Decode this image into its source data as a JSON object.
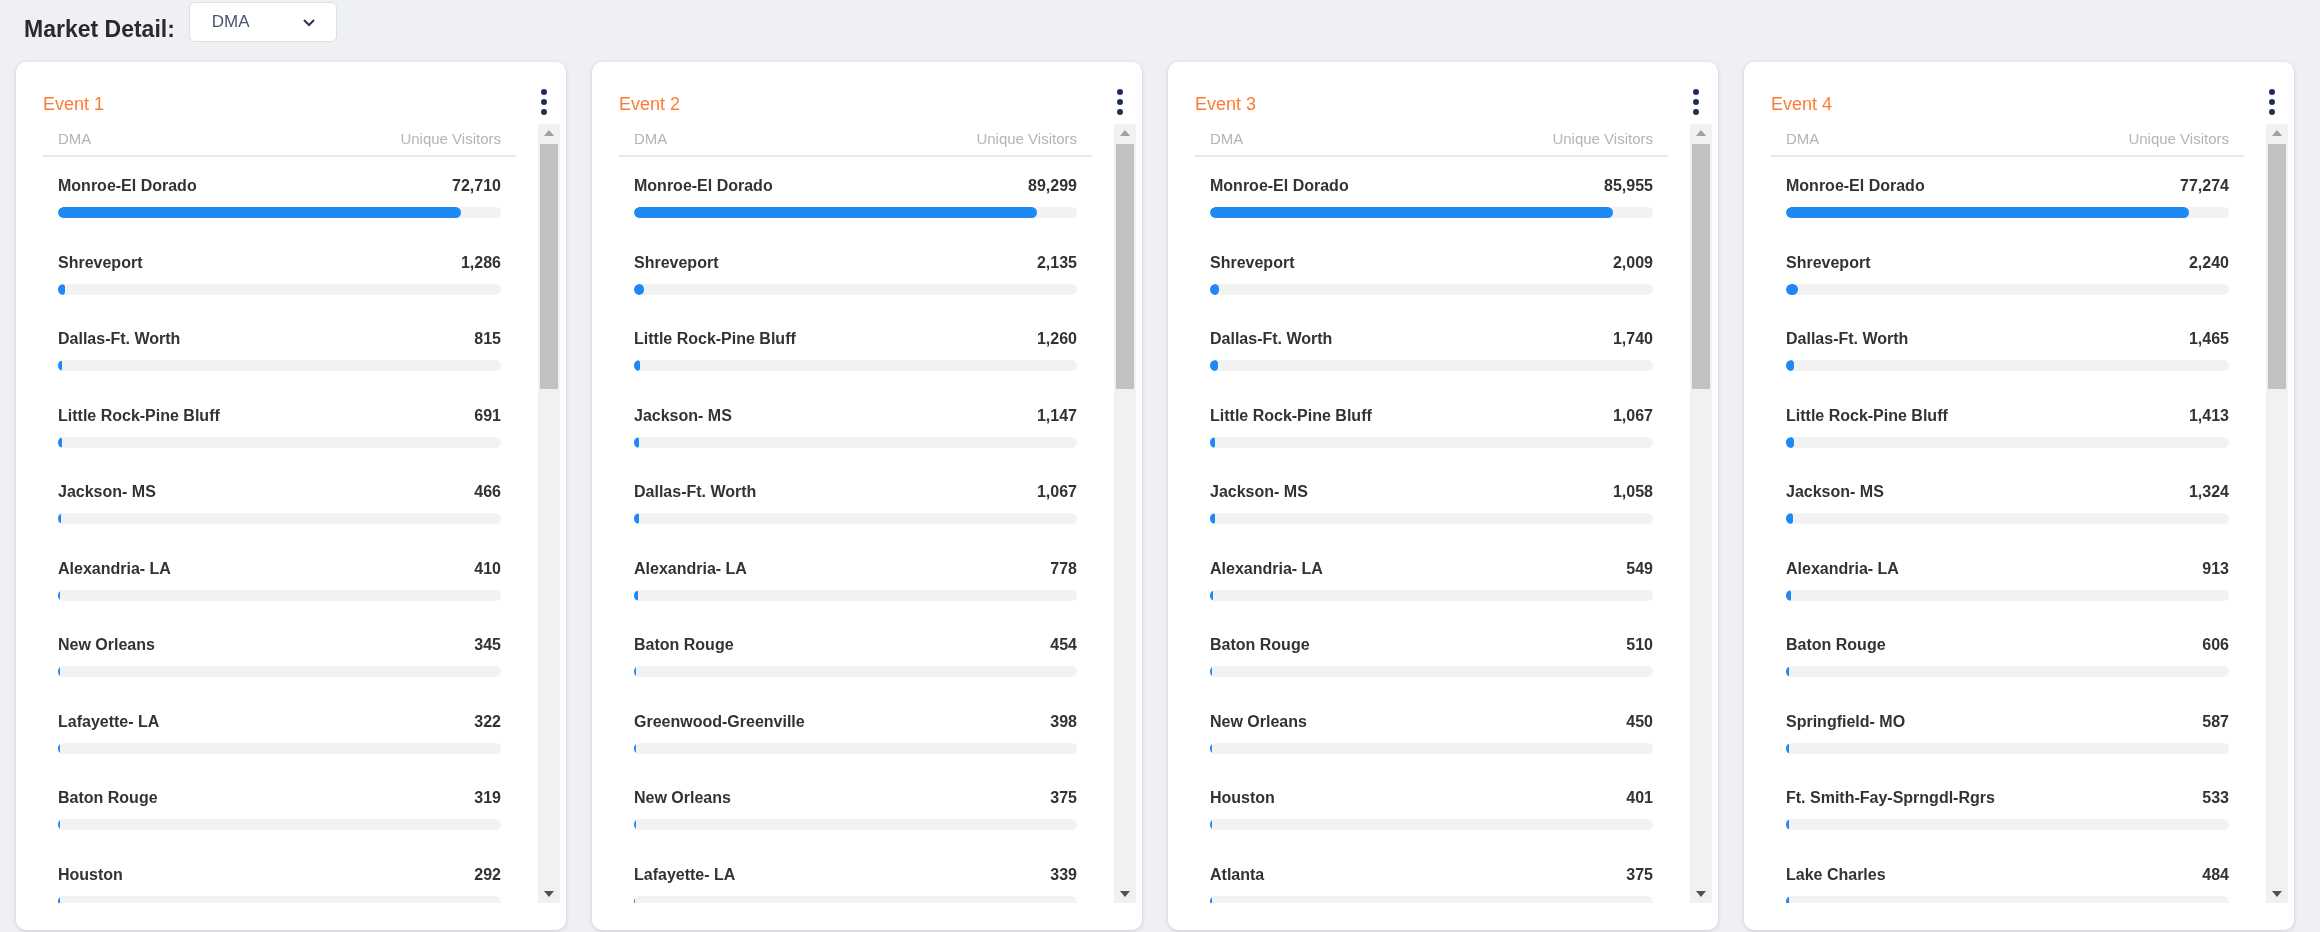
{
  "header": {
    "label": "Market Detail:",
    "dropdown": {
      "value": "DMA"
    }
  },
  "events": [
    {
      "title": "Event 1",
      "columns": [
        "DMA",
        "Unique Visitors"
      ],
      "rows": [
        {
          "name": "Monroe-El Dorado",
          "value": "72,710",
          "level": 0.91
        },
        {
          "name": "Shreveport",
          "value": "1,286",
          "level": 0.016
        },
        {
          "name": "Dallas-Ft. Worth",
          "value": "815",
          "level": 0.01
        },
        {
          "name": "Little Rock-Pine Bluff",
          "value": "691",
          "level": 0.009
        },
        {
          "name": "Jackson- MS",
          "value": "466",
          "level": 0.006
        },
        {
          "name": "Alexandria- LA",
          "value": "410",
          "level": 0.005
        },
        {
          "name": "New Orleans",
          "value": "345",
          "level": 0.004
        },
        {
          "name": "Lafayette- LA",
          "value": "322",
          "level": 0.004
        },
        {
          "name": "Baton Rouge",
          "value": "319",
          "level": 0.004
        },
        {
          "name": "Houston",
          "value": "292",
          "level": 0.004
        }
      ]
    },
    {
      "title": "Event 2",
      "columns": [
        "DMA",
        "Unique Visitors"
      ],
      "rows": [
        {
          "name": "Monroe-El Dorado",
          "value": "89,299",
          "level": 0.91
        },
        {
          "name": "Shreveport",
          "value": "2,135",
          "level": 0.022
        },
        {
          "name": "Little Rock-Pine Bluff",
          "value": "1,260",
          "level": 0.013
        },
        {
          "name": "Jackson- MS",
          "value": "1,147",
          "level": 0.012
        },
        {
          "name": "Dallas-Ft. Worth",
          "value": "1,067",
          "level": 0.011
        },
        {
          "name": "Alexandria- LA",
          "value": "778",
          "level": 0.008
        },
        {
          "name": "Baton Rouge",
          "value": "454",
          "level": 0.005
        },
        {
          "name": "Greenwood-Greenville",
          "value": "398",
          "level": 0.004
        },
        {
          "name": "New Orleans",
          "value": "375",
          "level": 0.004
        },
        {
          "name": "Lafayette- LA",
          "value": "339",
          "level": 0.003
        }
      ]
    },
    {
      "title": "Event 3",
      "columns": [
        "DMA",
        "Unique Visitors"
      ],
      "rows": [
        {
          "name": "Monroe-El Dorado",
          "value": "85,955",
          "level": 0.91
        },
        {
          "name": "Shreveport",
          "value": "2,009",
          "level": 0.021
        },
        {
          "name": "Dallas-Ft. Worth",
          "value": "1,740",
          "level": 0.018
        },
        {
          "name": "Little Rock-Pine Bluff",
          "value": "1,067",
          "level": 0.011
        },
        {
          "name": "Jackson- MS",
          "value": "1,058",
          "level": 0.011
        },
        {
          "name": "Alexandria- LA",
          "value": "549",
          "level": 0.006
        },
        {
          "name": "Baton Rouge",
          "value": "510",
          "level": 0.005
        },
        {
          "name": "New Orleans",
          "value": "450",
          "level": 0.005
        },
        {
          "name": "Houston",
          "value": "401",
          "level": 0.004
        },
        {
          "name": "Atlanta",
          "value": "375",
          "level": 0.004
        }
      ]
    },
    {
      "title": "Event 4",
      "columns": [
        "DMA",
        "Unique Visitors"
      ],
      "rows": [
        {
          "name": "Monroe-El Dorado",
          "value": "77,274",
          "level": 0.91
        },
        {
          "name": "Shreveport",
          "value": "2,240",
          "level": 0.026
        },
        {
          "name": "Dallas-Ft. Worth",
          "value": "1,465",
          "level": 0.017
        },
        {
          "name": "Little Rock-Pine Bluff",
          "value": "1,413",
          "level": 0.017
        },
        {
          "name": "Jackson- MS",
          "value": "1,324",
          "level": 0.016
        },
        {
          "name": "Alexandria- LA",
          "value": "913",
          "level": 0.011
        },
        {
          "name": "Baton Rouge",
          "value": "606",
          "level": 0.007
        },
        {
          "name": "Springfield- MO",
          "value": "587",
          "level": 0.007
        },
        {
          "name": "Ft. Smith-Fay-Sprngdl-Rgrs",
          "value": "533",
          "level": 0.006
        },
        {
          "name": "Lake Charles",
          "value": "484",
          "level": 0.006
        }
      ]
    }
  ]
}
